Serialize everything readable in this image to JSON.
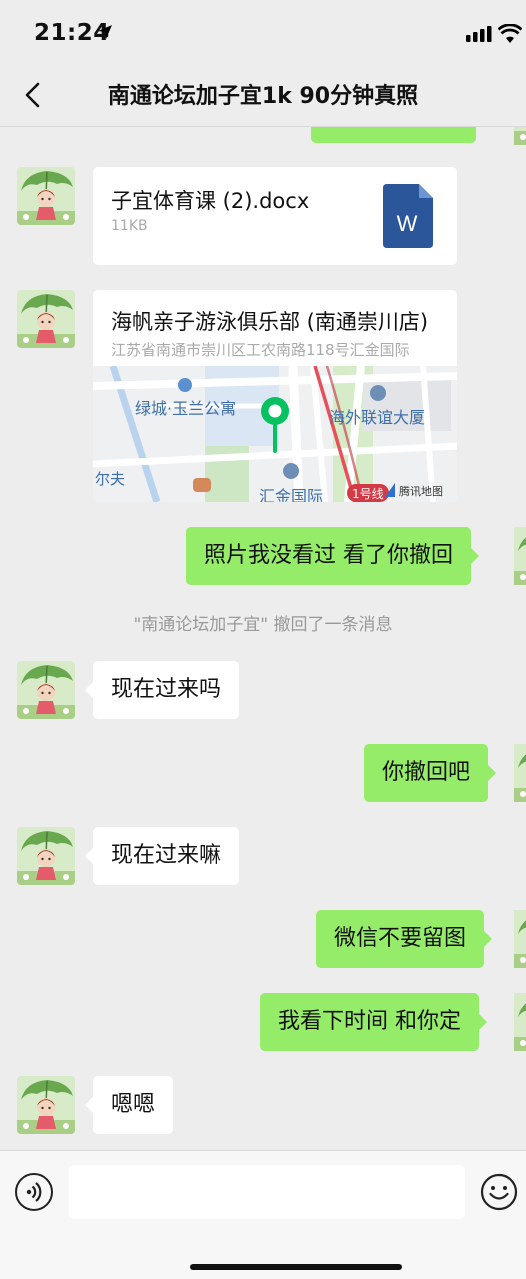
{
  "status_bar": {
    "time": "21:24"
  },
  "header": {
    "title": "南通论坛加子宜1k  90分钟真照"
  },
  "messages": [
    {
      "type": "file",
      "from": "other",
      "file_name": "子宜体育课 (2).docx",
      "file_size": "11KB",
      "icon": "word-doc-icon",
      "icon_letter": "W"
    },
    {
      "type": "location",
      "from": "other",
      "place_name": "海帆亲子游泳俱乐部 (南通崇川店)",
      "address": "江苏省南通市崇川区工农南路118号汇金国际",
      "map_labels": [
        "绿城·玉兰公寓",
        "海外联谊大厦",
        "汇金国际",
        "1号线",
        "尔夫",
        "腾讯地图"
      ]
    },
    {
      "type": "text",
      "from": "me",
      "text": "照片我没看过 看了你撤回"
    },
    {
      "type": "system",
      "text": "\"南通论坛加子宜\" 撤回了一条消息"
    },
    {
      "type": "text",
      "from": "other",
      "text": "现在过来吗"
    },
    {
      "type": "text",
      "from": "me",
      "text": "你撤回吧"
    },
    {
      "type": "text",
      "from": "other",
      "text": "现在过来嘛"
    },
    {
      "type": "text",
      "from": "me",
      "text": "微信不要留图"
    },
    {
      "type": "text",
      "from": "me",
      "text": "我看下时间 和你定"
    },
    {
      "type": "text",
      "from": "other",
      "text": "嗯嗯"
    }
  ],
  "input": {
    "value": "",
    "placeholder": ""
  },
  "colors": {
    "background": "#ededed",
    "bubble_in": "#ffffff",
    "bubble_out": "#95ec69",
    "word_blue": "#2b579a",
    "map_pin": "#07c160"
  }
}
